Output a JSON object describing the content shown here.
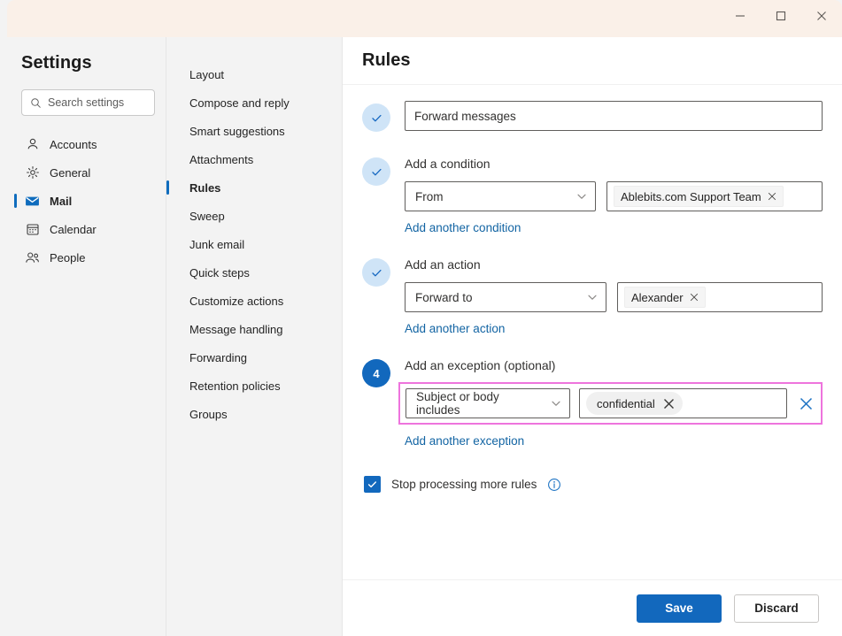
{
  "titlebar": {
    "minimize": "minimize-icon",
    "maximize": "maximize-icon",
    "close": "close-icon"
  },
  "sidebar": {
    "title": "Settings",
    "search": {
      "placeholder": "Search settings",
      "value": ""
    },
    "items": [
      {
        "label": "Accounts",
        "icon": "person-icon",
        "active": false
      },
      {
        "label": "General",
        "icon": "gear-icon",
        "active": false
      },
      {
        "label": "Mail",
        "icon": "envelope-icon",
        "active": true
      },
      {
        "label": "Calendar",
        "icon": "calendar-icon",
        "active": false
      },
      {
        "label": "People",
        "icon": "people-icon",
        "active": false
      }
    ]
  },
  "subnav": {
    "items": [
      {
        "label": "Layout",
        "active": false
      },
      {
        "label": "Compose and reply",
        "active": false
      },
      {
        "label": "Smart suggestions",
        "active": false
      },
      {
        "label": "Attachments",
        "active": false
      },
      {
        "label": "Rules",
        "active": true
      },
      {
        "label": "Sweep",
        "active": false
      },
      {
        "label": "Junk email",
        "active": false
      },
      {
        "label": "Quick steps",
        "active": false
      },
      {
        "label": "Customize actions",
        "active": false
      },
      {
        "label": "Message handling",
        "active": false
      },
      {
        "label": "Forwarding",
        "active": false
      },
      {
        "label": "Retention policies",
        "active": false
      },
      {
        "label": "Groups",
        "active": false
      }
    ]
  },
  "main": {
    "title": "Rules",
    "step_name": {
      "badge": "check",
      "input_value": "Forward messages",
      "input_placeholder": "Name your rule"
    },
    "step_condition": {
      "badge": "check",
      "label": "Add a condition",
      "select_value": "From",
      "tag": "Ablebits.com Support Team",
      "add_link": "Add another condition"
    },
    "step_action": {
      "badge": "check",
      "label": "Add an action",
      "select_value": "Forward to",
      "tag": "Alexander",
      "add_link": "Add another action"
    },
    "step_exception": {
      "badge": "4",
      "label": "Add an exception (optional)",
      "select_value": "Subject or body includes",
      "tag": "confidential",
      "add_link": "Add another exception",
      "highlight_color": "#ee74dd"
    },
    "stop_processing": {
      "label": "Stop processing more rules",
      "checked": true,
      "info_icon": "info-icon"
    },
    "footer": {
      "save_label": "Save",
      "discard_label": "Discard"
    }
  },
  "colors": {
    "accent": "#1268bd",
    "link": "#1264a3",
    "highlight": "#ee74dd",
    "titlebar": "#faf0e8"
  }
}
